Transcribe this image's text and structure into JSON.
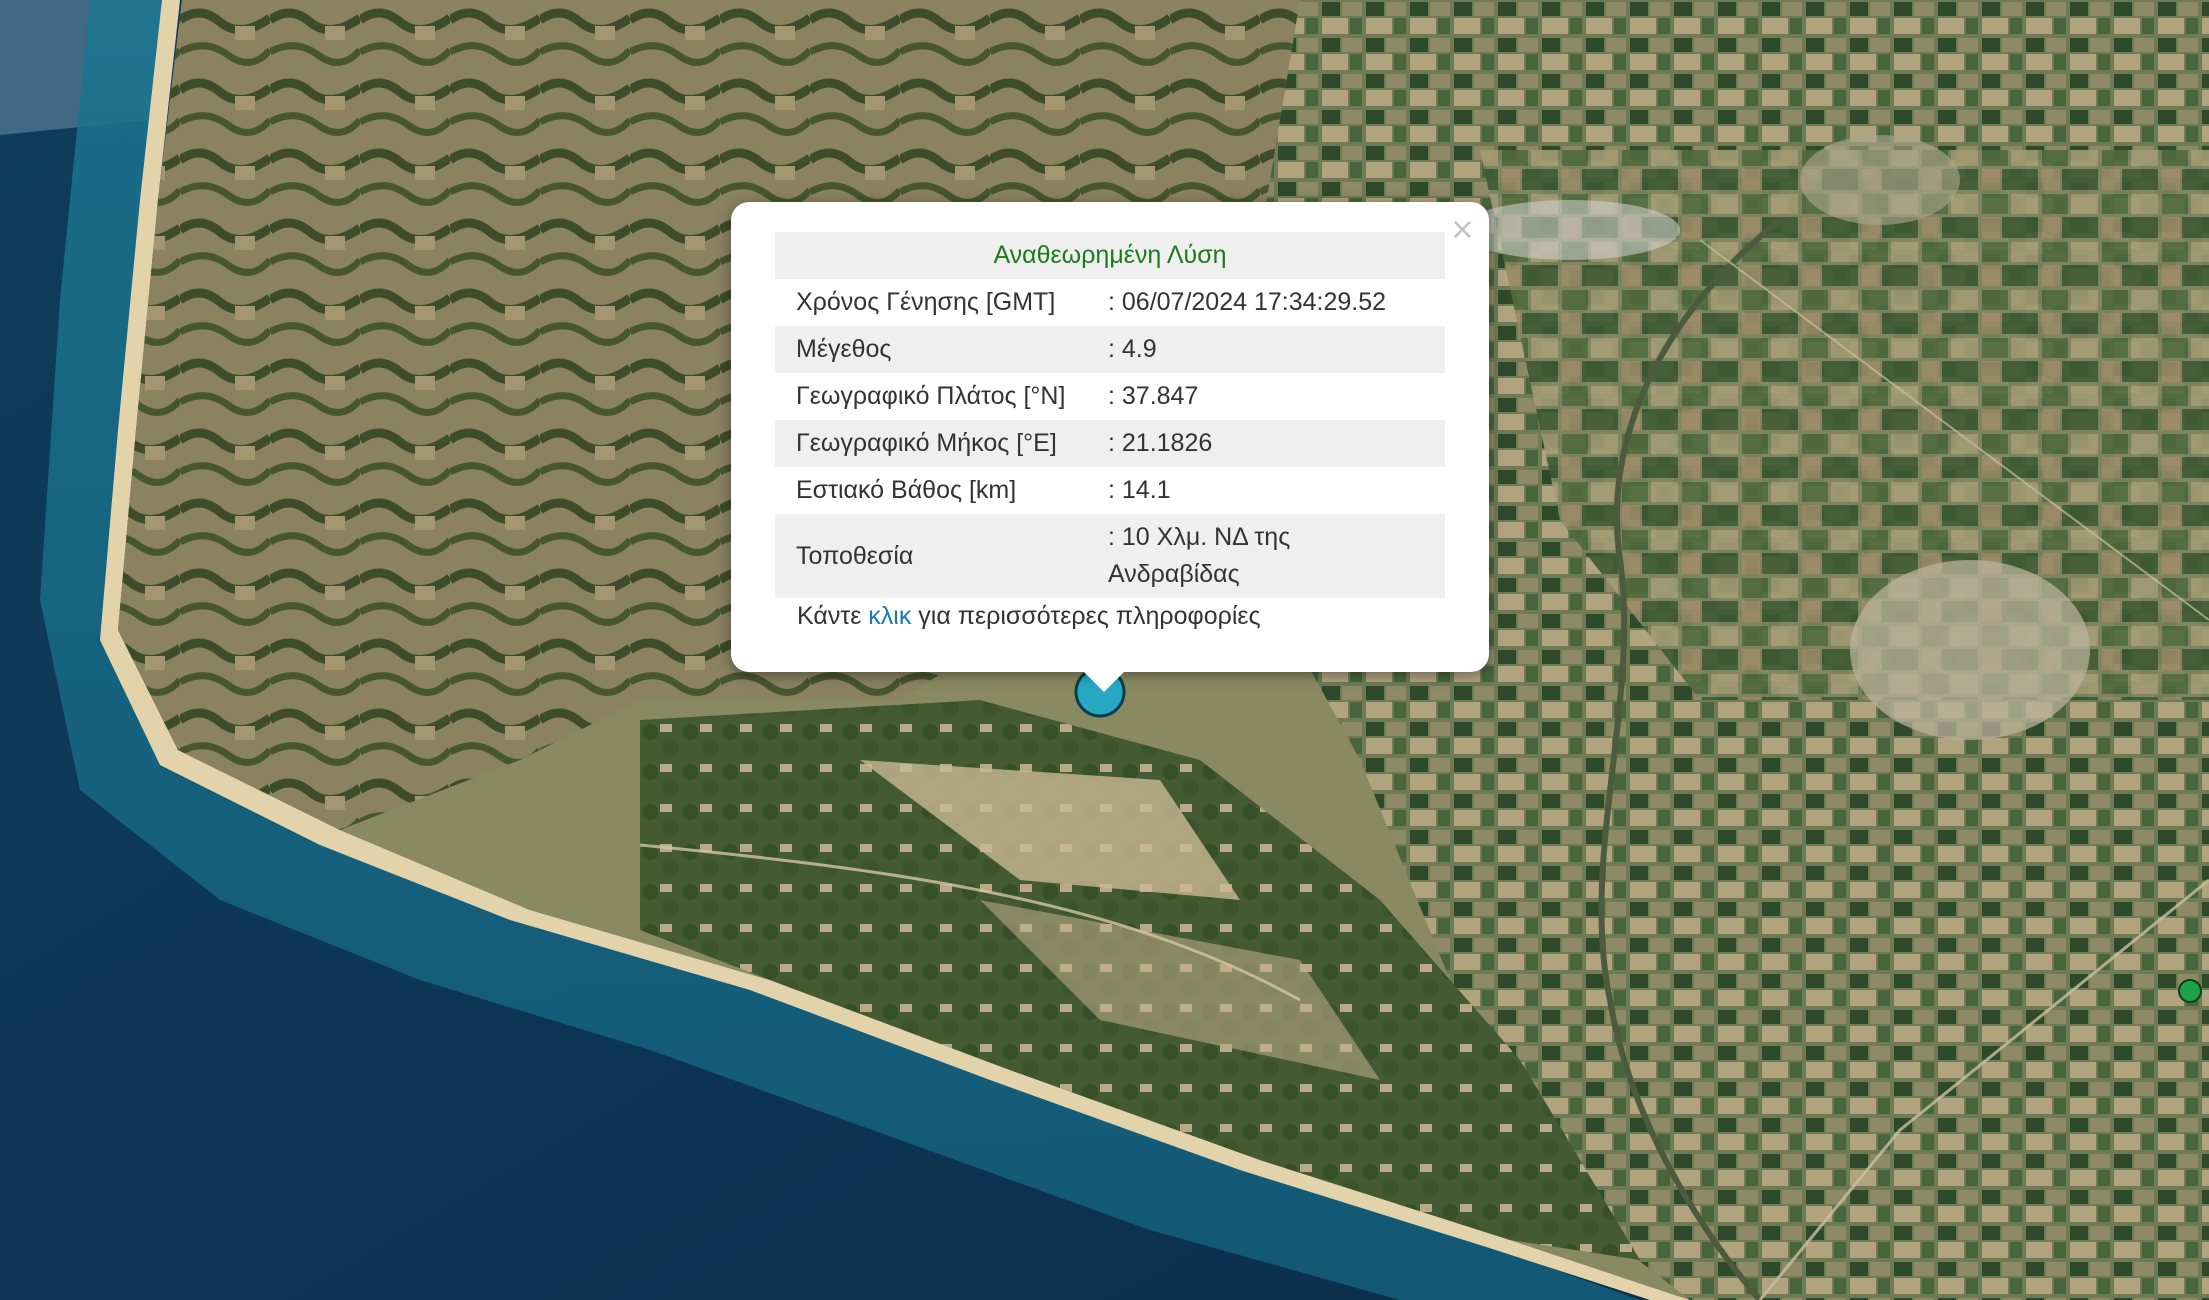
{
  "popup": {
    "title": "Αναθεωρημένη Λύση",
    "close_symbol": "×",
    "rows": [
      {
        "label": "Χρόνος Γένησης [GMT]",
        "value": ": 06/07/2024 17:34:29.52"
      },
      {
        "label": "Μέγεθος",
        "value": ": 4.9"
      },
      {
        "label": "Γεωγραφικό Πλάτος [°N]",
        "value": ": 37.847"
      },
      {
        "label": "Γεωγραφικό Μήκος [°E]",
        "value": ": 21.1826"
      },
      {
        "label": "Εστιακό Βάθος [km]",
        "value": ": 14.1"
      },
      {
        "label": "Τοποθεσία",
        "value": ": 10 Χλμ. ΝΔ της Ανδραβίδας"
      }
    ],
    "more_prefix": "Κάντε ",
    "more_link": "κλικ",
    "more_suffix": " για περισσότερες πληροφορίες"
  },
  "markers": [
    {
      "name": "earthquake-marker",
      "color": "#27a9c4"
    },
    {
      "name": "station-marker",
      "color": "#1fa34a"
    }
  ],
  "colors": {
    "sea_deep": "#0e3b5a",
    "sea_shallow": "#1d7a92",
    "beach": "#e3d3ac",
    "land": "#8d8a62",
    "forest": "#3a4f2a",
    "title_green": "#1c7a1c",
    "link_blue": "#1c7ab0"
  }
}
